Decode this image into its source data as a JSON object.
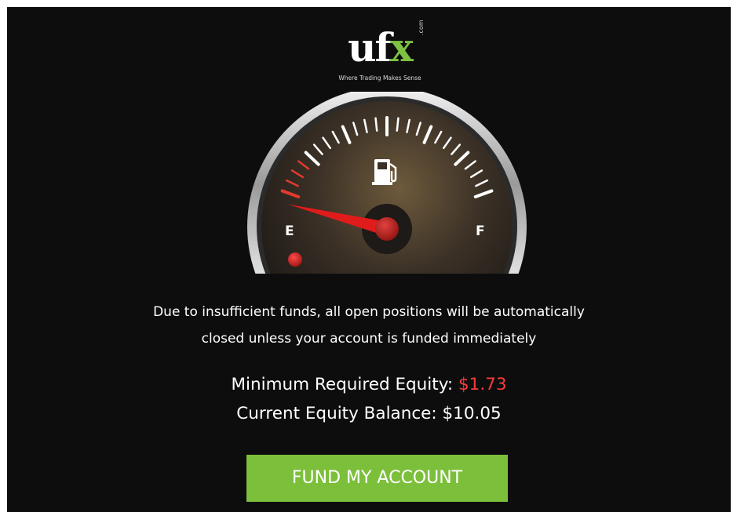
{
  "brand": {
    "logo_main": "uf",
    "logo_accent": "x",
    "logo_dotcom": ".com",
    "tagline": "Where Trading Makes Sense"
  },
  "gauge": {
    "empty_label": "E",
    "full_label": "F",
    "icon": "fuel-pump-icon",
    "level": 0.0,
    "warning_light": "on"
  },
  "message": {
    "line1": "Due to insufficient funds, all open positions will be automatically",
    "line2": "closed unless your account is funded immediately"
  },
  "equity": {
    "minimum_label": "Minimum Required Equity:",
    "minimum_value": "$1.73",
    "current_label": "Current Equity Balance:",
    "current_value": "$10.05"
  },
  "cta": {
    "label": "FUND MY ACCOUNT"
  },
  "colors": {
    "background": "#0d0d0d",
    "accent_green": "#7cbf3b",
    "alert_red": "#ff3b3b",
    "text": "#ffffff"
  }
}
